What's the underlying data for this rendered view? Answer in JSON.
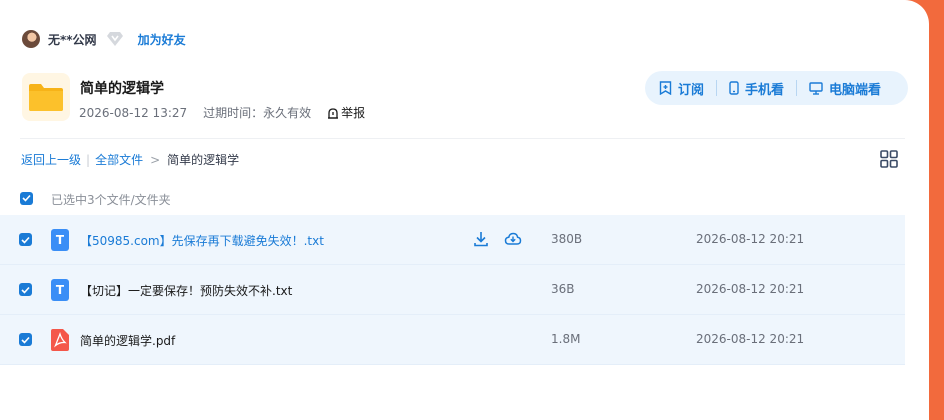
{
  "sharer": {
    "name": "无**公网",
    "add_friend_label": "加为好友"
  },
  "folder": {
    "title": "简单的逻辑学",
    "date": "2026-08-12 13:27",
    "expire_label": "过期时间：永久有效",
    "report_label": "举报"
  },
  "actions": {
    "subscribe": "订阅",
    "mobile": "手机看",
    "desktop": "电脑端看"
  },
  "breadcrumb": {
    "back": "返回上一级",
    "all_files": "全部文件",
    "current": "简单的逻辑学"
  },
  "selection": {
    "summary": "已选中3个文件/文件夹"
  },
  "files": [
    {
      "name": "【50985.com】先保存再下载避免失效！.txt",
      "type": "txt",
      "type_letter": "T",
      "size": "380B",
      "time": "2026-08-12 20:21"
    },
    {
      "name": "【切记】一定要保存！预防失效不补.txt",
      "type": "txt",
      "type_letter": "T",
      "size": "36B",
      "time": "2026-08-12 20:21"
    },
    {
      "name": "简单的逻辑学.pdf",
      "type": "pdf",
      "type_letter": "",
      "size": "1.8M",
      "time": "2026-08-12 20:21"
    }
  ],
  "colors": {
    "accent": "#1a7bd6",
    "page_bg": "#f26a3d",
    "row_bg": "#eff6fd",
    "folder_yellow": "#fcc12b",
    "txt_blue": "#3a8ef6",
    "pdf_red": "#f4574a"
  },
  "icons": [
    "vip-diamond-icon",
    "folder-icon",
    "report-icon",
    "subscribe-icon",
    "phone-icon",
    "monitor-icon",
    "grid-view-icon",
    "download-icon",
    "cloud-save-icon",
    "txt-file-icon",
    "pdf-file-icon"
  ]
}
